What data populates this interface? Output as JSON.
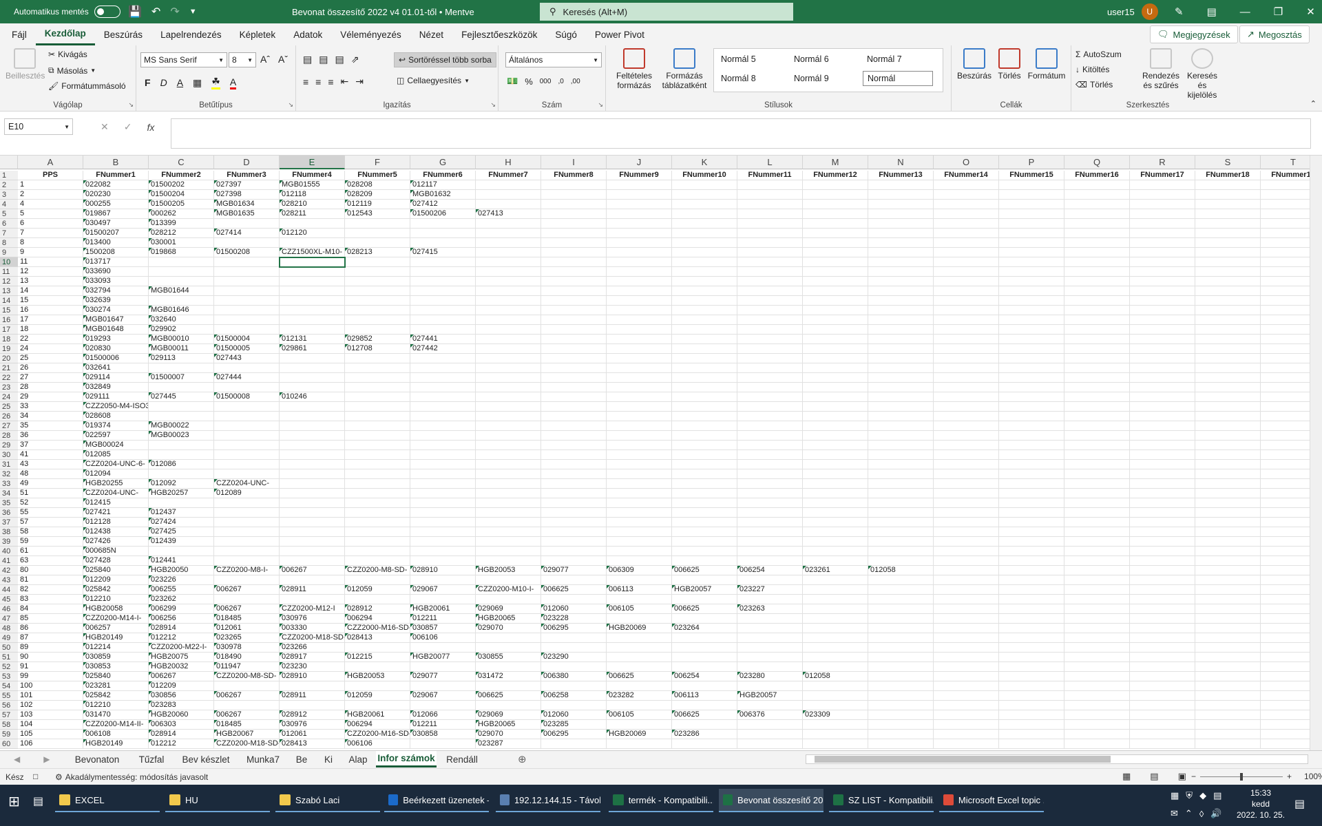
{
  "titlebar": {
    "autosave_label": "Automatikus mentés",
    "doc_title": "Bevonat összesítő 2022 v4 01.01-től • Mentve",
    "search_placeholder": "Keresés (Alt+M)",
    "user": "user15",
    "avatar": "U"
  },
  "menu": {
    "tabs": [
      "Fájl",
      "Kezdőlap",
      "Beszúrás",
      "Lapelrendezés",
      "Képletek",
      "Adatok",
      "Véleményezés",
      "Nézet",
      "Fejlesztőeszközök",
      "Súgó",
      "Power Pivot"
    ],
    "comments": "Megjegyzések",
    "share": "Megosztás"
  },
  "ribbon": {
    "clipboard": {
      "label": "Vágólap",
      "paste": "Beillesztés",
      "cut": "Kivágás",
      "copy": "Másolás",
      "painter": "Formátummásoló"
    },
    "font": {
      "label": "Betűtípus",
      "family": "MS Sans Serif",
      "size": "8",
      "bold": "F",
      "italic": "D",
      "underline": "A"
    },
    "alignment": {
      "label": "Igazítás",
      "wrap": "Sortöréssel több sorba",
      "merge": "Cellaegyesítés"
    },
    "number": {
      "label": "Szám",
      "format": "Általános"
    },
    "styles": {
      "label": "Stílusok",
      "cond": "Feltételes formázás",
      "table": "Formázás táblázatként",
      "cells": [
        "Normál 5",
        "Normál 6",
        "Normál 7",
        "Normál 8",
        "Normál 9",
        "Normál"
      ]
    },
    "cells": {
      "label": "Cellák",
      "insert": "Beszúrás",
      "delete": "Törlés",
      "format": "Formátum"
    },
    "editing": {
      "label": "Szerkesztés",
      "autosum": "AutoSzum",
      "fill": "Kitöltés",
      "clear": "Törlés",
      "sort": "Rendezés és szűrés",
      "find": "Keresés és kijelölés"
    }
  },
  "formula": {
    "namebox": "E10",
    "fx": "fx",
    "content": ""
  },
  "columns": [
    "A",
    "B",
    "C",
    "D",
    "E",
    "F",
    "G",
    "H",
    "I",
    "J",
    "K",
    "L",
    "M",
    "N",
    "O",
    "P",
    "Q",
    "R",
    "S",
    "T"
  ],
  "rows": [
    {
      "n": "1",
      "c": [
        "PPS",
        "FNummer1",
        "FNummer2",
        "FNummer3",
        "FNummer4",
        "FNummer5",
        "FNummer6",
        "FNummer7",
        "FNummer8",
        "FNummer9",
        "FNummer10",
        "FNummer11",
        "FNummer12",
        "FNummer13",
        "FNummer14",
        "FNummer15",
        "FNummer16",
        "FNummer17",
        "FNummer18",
        "FNummer19"
      ]
    },
    {
      "n": "2",
      "c": [
        "1",
        "022082",
        "01500202",
        "027397",
        "MGB01555",
        "028208",
        "012117"
      ]
    },
    {
      "n": "3",
      "c": [
        "2",
        "020230",
        "01500204",
        "027398",
        "012118",
        "028209",
        "MGB01632"
      ]
    },
    {
      "n": "4",
      "c": [
        "4",
        "000255",
        "01500205",
        "MGB01634",
        "028210",
        "012119",
        "027412"
      ]
    },
    {
      "n": "5",
      "c": [
        "5",
        "019867",
        "000262",
        "MGB01635",
        "028211",
        "012543",
        "01500206",
        "027413"
      ]
    },
    {
      "n": "6",
      "c": [
        "6",
        "030497",
        "013399"
      ]
    },
    {
      "n": "7",
      "c": [
        "7",
        "01500207",
        "028212",
        "027414",
        "012120"
      ]
    },
    {
      "n": "8",
      "c": [
        "8",
        "013400",
        "030001"
      ]
    },
    {
      "n": "9",
      "c": [
        "9",
        "1500208",
        "019868",
        "01500208",
        "CZZ1500XL-M10-",
        "028213",
        "027415"
      ]
    },
    {
      "n": "10",
      "c": [
        "11",
        "013717"
      ]
    },
    {
      "n": "11",
      "c": [
        "12",
        "033690"
      ]
    },
    {
      "n": "12",
      "c": [
        "13",
        "033093"
      ]
    },
    {
      "n": "13",
      "c": [
        "14",
        "032794",
        "MGB01644"
      ]
    },
    {
      "n": "14",
      "c": [
        "15",
        "032639"
      ]
    },
    {
      "n": "15",
      "c": [
        "16",
        "030274",
        "MGB01646"
      ]
    },
    {
      "n": "16",
      "c": [
        "17",
        "MGB01647",
        "032640"
      ]
    },
    {
      "n": "17",
      "c": [
        "18",
        "MGB01648",
        "029902"
      ]
    },
    {
      "n": "18",
      "c": [
        "22",
        "019293",
        "MGB00010",
        "01500004",
        "012131",
        "029852",
        "027441"
      ]
    },
    {
      "n": "19",
      "c": [
        "24",
        "020830",
        "MGB00011",
        "01500005",
        "029861",
        "012708",
        "027442"
      ]
    },
    {
      "n": "20",
      "c": [
        "25",
        "01500006",
        "029113",
        "027443"
      ]
    },
    {
      "n": "21",
      "c": [
        "26",
        "032641"
      ]
    },
    {
      "n": "22",
      "c": [
        "27",
        "029114",
        "01500007",
        "027444"
      ]
    },
    {
      "n": "23",
      "c": [
        "28",
        "032849"
      ]
    },
    {
      "n": "24",
      "c": [
        "29",
        "029111",
        "027445",
        "01500008",
        "010246"
      ]
    },
    {
      "n": "25",
      "c": [
        "33",
        "CZZ2050-M4-ISO3"
      ]
    },
    {
      "n": "26",
      "c": [
        "34",
        "028608"
      ]
    },
    {
      "n": "27",
      "c": [
        "35",
        "019374",
        "MGB00022"
      ]
    },
    {
      "n": "28",
      "c": [
        "36",
        "022597",
        "MGB00023"
      ]
    },
    {
      "n": "29",
      "c": [
        "37",
        "MGB00024"
      ]
    },
    {
      "n": "30",
      "c": [
        "41",
        "012085"
      ]
    },
    {
      "n": "31",
      "c": [
        "43",
        "CZZ0204-UNC-6-",
        "012086"
      ]
    },
    {
      "n": "32",
      "c": [
        "48",
        "012094"
      ]
    },
    {
      "n": "33",
      "c": [
        "49",
        "HGB20255",
        "012092",
        "CZZ0204-UNC-"
      ]
    },
    {
      "n": "34",
      "c": [
        "51",
        "CZZ0204-UNC-",
        "HGB20257",
        "012089"
      ]
    },
    {
      "n": "35",
      "c": [
        "52",
        "012415"
      ]
    },
    {
      "n": "36",
      "c": [
        "55",
        "027421",
        "012437"
      ]
    },
    {
      "n": "37",
      "c": [
        "57",
        "012128",
        "027424"
      ]
    },
    {
      "n": "38",
      "c": [
        "58",
        "012438",
        "027425"
      ]
    },
    {
      "n": "39",
      "c": [
        "59",
        "027426",
        "012439"
      ]
    },
    {
      "n": "40",
      "c": [
        "61",
        "000685N"
      ]
    },
    {
      "n": "41",
      "c": [
        "63",
        "027428",
        "012441"
      ]
    },
    {
      "n": "42",
      "c": [
        "80",
        "025840",
        "HGB20050",
        "CZZ0200-M8-I-",
        "006267",
        "CZZ0200-M8-SD-",
        "028910",
        "HGB20053",
        "029077",
        "006309",
        "006625",
        "006254",
        "023261",
        "012058"
      ]
    },
    {
      "n": "43",
      "c": [
        "81",
        "012209",
        "023226"
      ]
    },
    {
      "n": "44",
      "c": [
        "82",
        "025842",
        "006255",
        "006267",
        "028911",
        "012059",
        "029067",
        "CZZ0200-M10-I-",
        "006625",
        "006113",
        "HGB20057",
        "023227"
      ]
    },
    {
      "n": "45",
      "c": [
        "83",
        "012210",
        "023262"
      ]
    },
    {
      "n": "46",
      "c": [
        "84",
        "HGB20058",
        "006299",
        "006267",
        "CZZ0200-M12-I",
        "028912",
        "HGB20061",
        "029069",
        "012060",
        "006105",
        "006625",
        "023263"
      ]
    },
    {
      "n": "47",
      "c": [
        "85",
        "CZZ0200-M14-I-",
        "006256",
        "018485",
        "030976",
        "006294",
        "012211",
        "HGB20065",
        "023228"
      ]
    },
    {
      "n": "48",
      "c": [
        "86",
        "006257",
        "028914",
        "012061",
        "003330",
        "CZZ2000-M16-SD-",
        "030857",
        "029070",
        "006295",
        "HGB20069",
        "023264"
      ]
    },
    {
      "n": "49",
      "c": [
        "87",
        "HGB20149",
        "012212",
        "023265",
        "CZZ0200-M18-SD-",
        "028413",
        "006106"
      ]
    },
    {
      "n": "50",
      "c": [
        "89",
        "012214",
        "CZZ0200-M22-I-",
        "030978",
        "023266"
      ]
    },
    {
      "n": "51",
      "c": [
        "90",
        "030859",
        "HGB20075",
        "018490",
        "028917",
        "012215",
        "HGB20077",
        "030855",
        "023290"
      ]
    },
    {
      "n": "52",
      "c": [
        "91",
        "030853",
        "HGB20032",
        "011947",
        "023230"
      ]
    },
    {
      "n": "53",
      "c": [
        "99",
        "025840",
        "006267",
        "CZZ0200-M8-SD-",
        "028910",
        "HGB20053",
        "029077",
        "031472",
        "006380",
        "006625",
        "006254",
        "023280",
        "012058"
      ]
    },
    {
      "n": "54",
      "c": [
        "100",
        "023281",
        "012209"
      ]
    },
    {
      "n": "55",
      "c": [
        "101",
        "025842",
        "030856",
        "006267",
        "028911",
        "012059",
        "029067",
        "006625",
        "006258",
        "023282",
        "006113",
        "HGB20057"
      ]
    },
    {
      "n": "56",
      "c": [
        "102",
        "012210",
        "023283"
      ]
    },
    {
      "n": "57",
      "c": [
        "103",
        "031470",
        "HGB20060",
        "006267",
        "028912",
        "HGB20061",
        "012066",
        "029069",
        "012060",
        "006105",
        "006625",
        "006376",
        "023309"
      ]
    },
    {
      "n": "58",
      "c": [
        "104",
        "CZZ0200-M14-II-",
        "006303",
        "018485",
        "030976",
        "006294",
        "012211",
        "HGB20065",
        "023285"
      ]
    },
    {
      "n": "59",
      "c": [
        "105",
        "006108",
        "028914",
        "HGB20067",
        "012061",
        "CZZ0200-M16-SD-",
        "030858",
        "029070",
        "006295",
        "HGB20069",
        "023286"
      ]
    },
    {
      "n": "60",
      "c": [
        "106",
        "HGB20149",
        "012212",
        "CZZ0200-M18-SD-",
        "028413",
        "006106",
        "",
        "023287"
      ]
    }
  ],
  "sheet_tabs": [
    "Bevonaton",
    "Tűzfal",
    "Bev készlet",
    "Munka7",
    "Be",
    "Ki",
    "Alap",
    "Infor számok",
    "Rendáll"
  ],
  "active_sheet": "Infor számok",
  "status": {
    "ready": "Kész",
    "accessibility": "Akadálymentesség: módosítás javasolt",
    "zoom": "100%"
  },
  "taskbar": {
    "items": [
      {
        "label": "EXCEL",
        "color": "#f2c94c"
      },
      {
        "label": "HU",
        "color": "#f2c94c"
      },
      {
        "label": "Szabó Laci",
        "color": "#f2c94c"
      },
      {
        "label": "Beérkezett üzenetek –...",
        "color": "#1b6ac9"
      },
      {
        "label": "192.12.144.15 - Távoli ...",
        "color": "#5a7fb0"
      },
      {
        "label": "termék - Kompatibili...",
        "color": "#1e7145"
      },
      {
        "label": "Bevonat összesítő 202...",
        "color": "#1e7145"
      },
      {
        "label": "SZ LIST - Kompatibili...",
        "color": "#1e7145"
      },
      {
        "label": "Microsoft Excel topic ...",
        "color": "#dd4b39"
      }
    ],
    "active": "Bevonat összesítő 202...",
    "time": "15:33",
    "day": "kedd",
    "date": "2022. 10. 25."
  }
}
